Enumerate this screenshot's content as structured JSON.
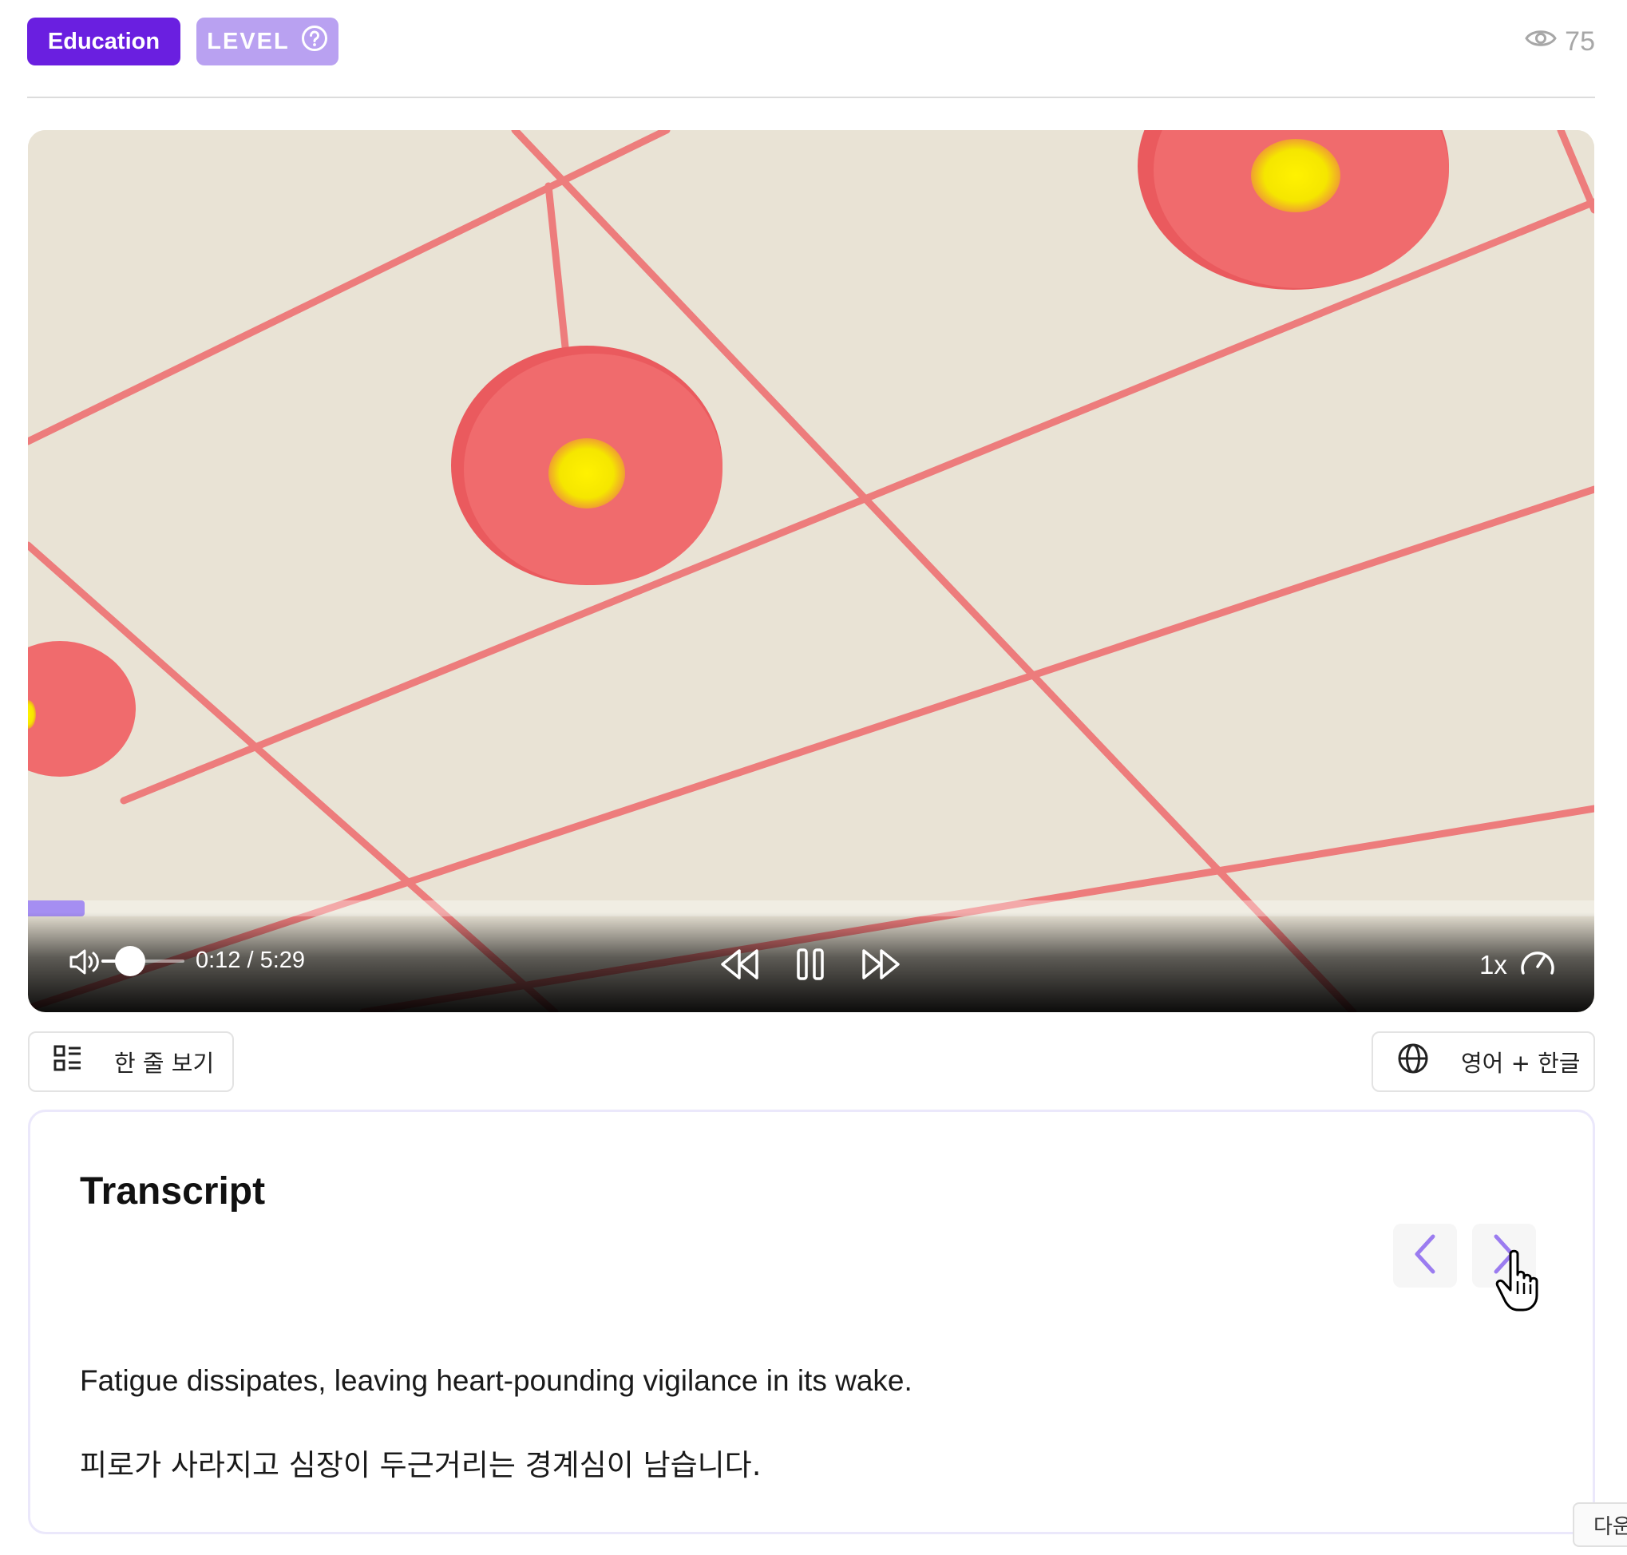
{
  "header": {
    "category": "Education",
    "level_label": "LEVEL",
    "help_icon": "question-circle-icon",
    "views_icon": "eye-icon",
    "views_count": "75"
  },
  "player": {
    "current_time": "0:12",
    "duration": "5:29",
    "time_display": "0:12 / 5:29",
    "progress_fraction": 0.036,
    "volume_fraction": 0.35,
    "speed_label": "1x",
    "icons": {
      "volume": "volume-icon",
      "rewind": "rewind-icon",
      "pause": "pause-icon",
      "forward": "fast-forward-icon",
      "speed": "speedometer-icon"
    },
    "accent_color": "#a58ef2"
  },
  "toolbar": {
    "line_view_label": "한 줄 보기",
    "line_view_icon": "list-view-icon",
    "language_label": "영어 + 한글",
    "language_icon": "globe-icon"
  },
  "transcript": {
    "title": "Transcript",
    "prev_icon": "chevron-left-icon",
    "next_icon": "chevron-right-icon",
    "english": "Fatigue dissipates, leaving heart-pounding vigilance in its wake.",
    "korean": "피로가 사라지고 심장이 두근거리는 경계심이 남습니다."
  },
  "corner_tab": {
    "label": "다운"
  },
  "colors": {
    "brand_purple": "#6a1fe0",
    "level_purple": "#b9a1f1",
    "chevron_purple": "#9b7cf0"
  }
}
